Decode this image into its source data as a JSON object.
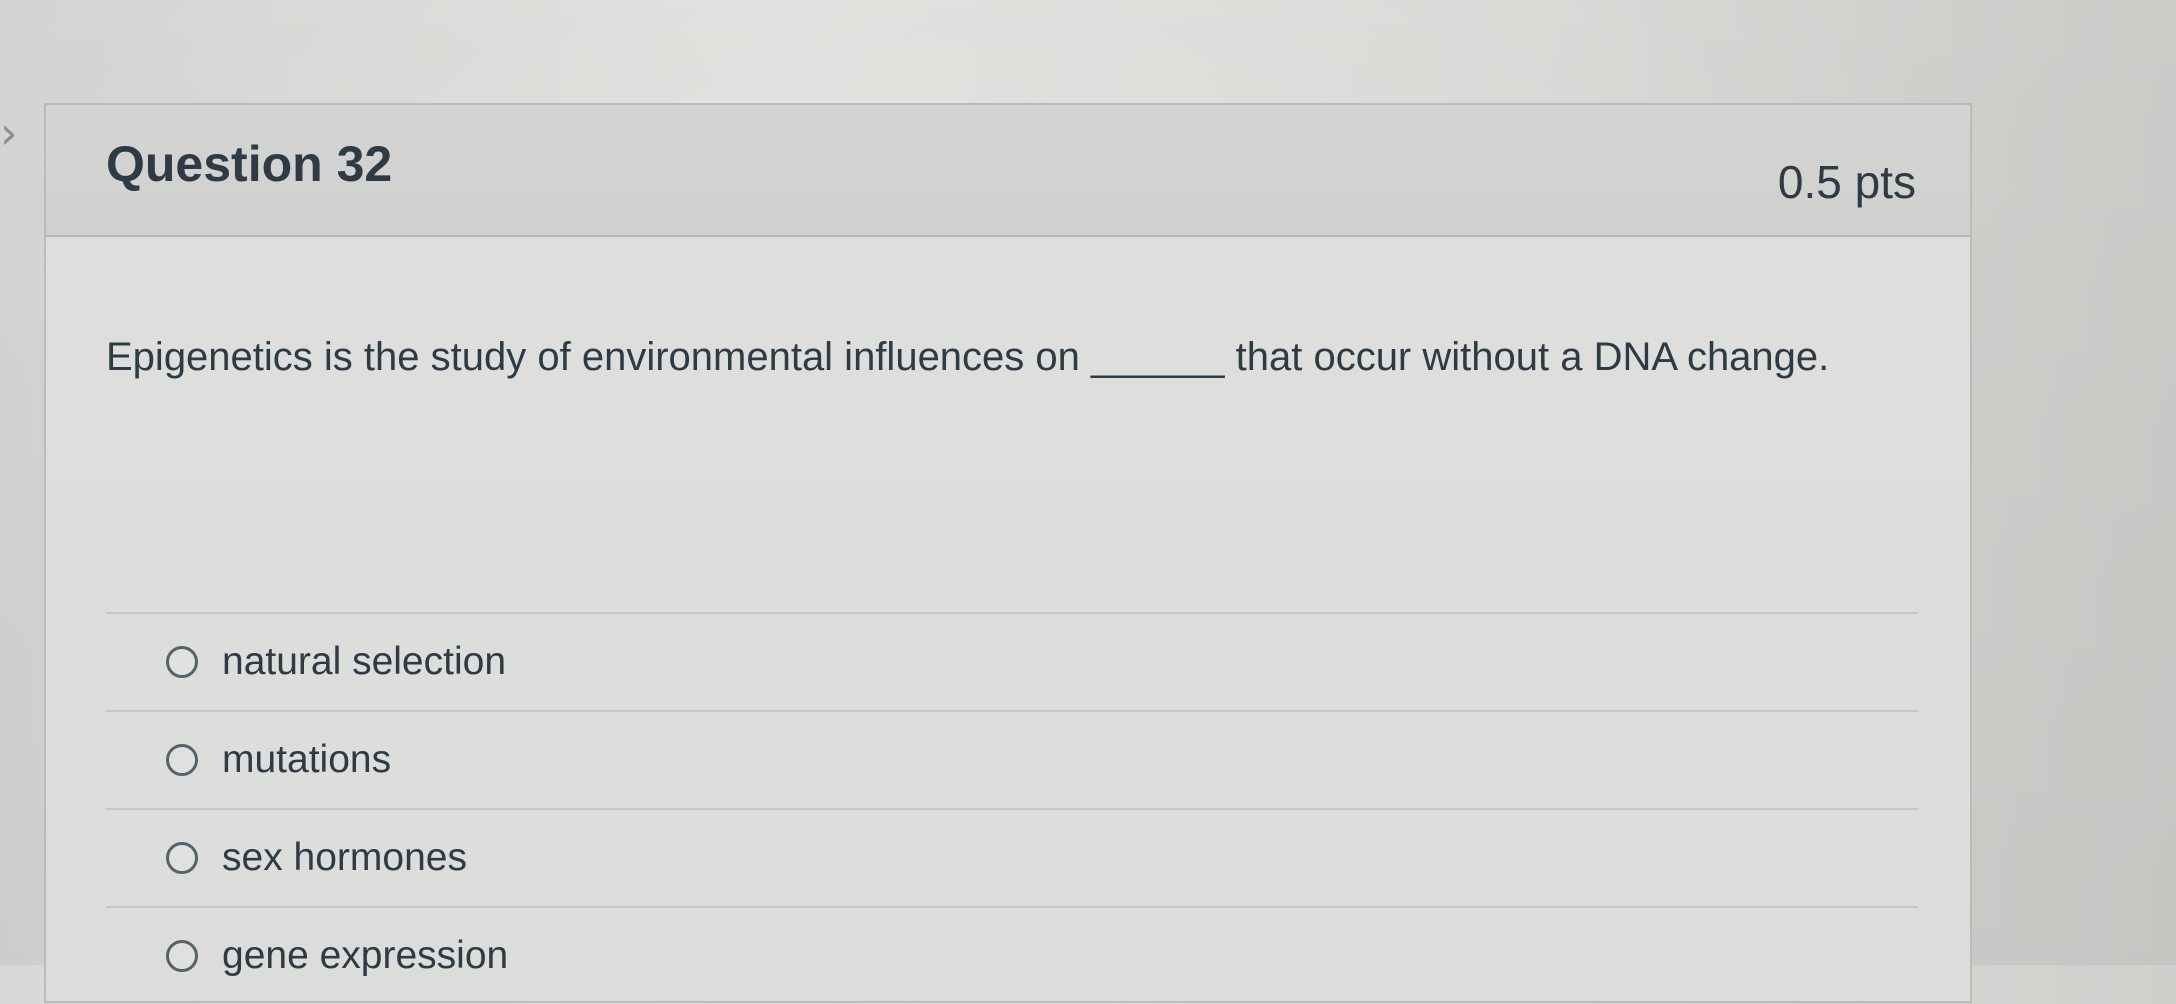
{
  "question": {
    "title": "Question 32",
    "points": "0.5 pts",
    "text": "Epigenetics is the study of environmental influences on ______ that occur without a DNA change.",
    "answers": [
      {
        "label": "natural selection",
        "selected": false
      },
      {
        "label": "mutations",
        "selected": false
      },
      {
        "label": "sex hormones",
        "selected": false
      },
      {
        "label": "gene expression",
        "selected": false
      }
    ]
  },
  "icons": {
    "nav_arrow": "chevron-right-icon",
    "radio": "radio-button"
  },
  "colors": {
    "text": "#2d3b45",
    "border": "#b9bcbe",
    "header_background": "#d4d4d2",
    "body_background": "#dededd"
  }
}
